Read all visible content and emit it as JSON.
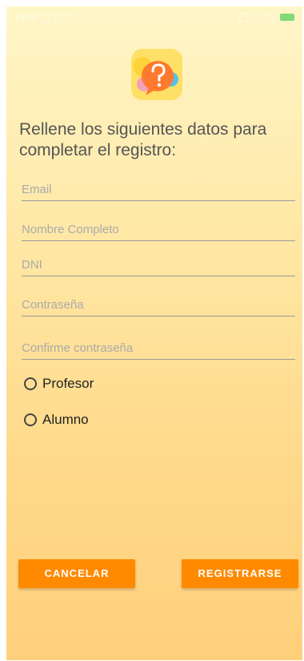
{
  "status_bar": {
    "time": "13:00"
  },
  "heading": "Rellene los siguientes datos para completar el registro:",
  "fields": [
    {
      "placeholder": "Email"
    },
    {
      "placeholder": "Nombre Completo"
    },
    {
      "placeholder": "DNI"
    },
    {
      "placeholder": "Contraseña"
    },
    {
      "placeholder": "Confirme contraseña"
    }
  ],
  "roles": [
    {
      "label": "Profesor",
      "selected": false
    },
    {
      "label": "Alumno",
      "selected": false
    }
  ],
  "buttons": {
    "cancel": "CANCELAR",
    "register": "REGISTRARSE"
  },
  "colors": {
    "accent": "#ff8a00",
    "background_top": "#fff6c8",
    "background_bottom": "#ffd07c"
  },
  "icons": {
    "logo": "question-bubble-icon"
  }
}
